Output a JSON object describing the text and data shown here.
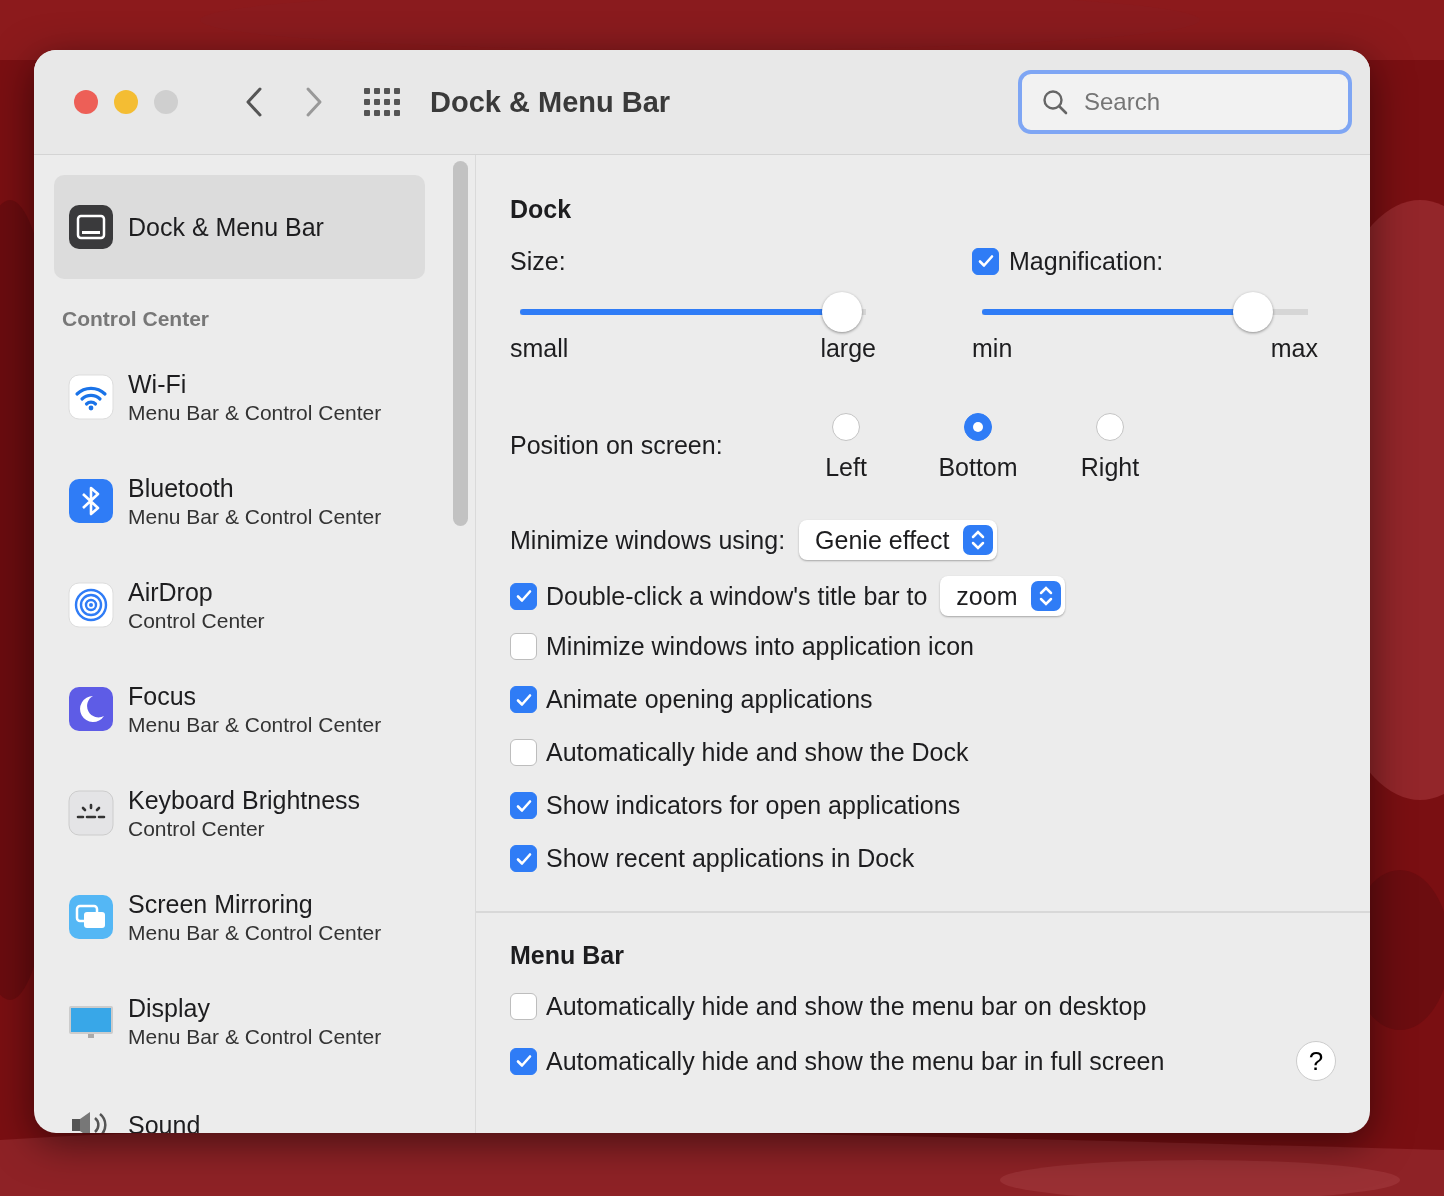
{
  "window": {
    "title": "Dock & Menu Bar"
  },
  "search": {
    "placeholder": "Search"
  },
  "sidebar": {
    "items": [
      {
        "kind": "item",
        "title": "Dock & Menu Bar",
        "selected": true
      },
      {
        "kind": "header",
        "title": "Control Center"
      },
      {
        "kind": "item",
        "title": "Wi-Fi",
        "subtitle": "Menu Bar & Control Center",
        "selected": false
      },
      {
        "kind": "item",
        "title": "Bluetooth",
        "subtitle": "Menu Bar & Control Center",
        "selected": false
      },
      {
        "kind": "item",
        "title": "AirDrop",
        "subtitle": "Control Center",
        "selected": false
      },
      {
        "kind": "item",
        "title": "Focus",
        "subtitle": "Menu Bar & Control Center",
        "selected": false
      },
      {
        "kind": "item",
        "title": "Keyboard Brightness",
        "subtitle": "Control Center",
        "selected": false
      },
      {
        "kind": "item",
        "title": "Screen Mirroring",
        "subtitle": "Menu Bar & Control Center",
        "selected": false
      },
      {
        "kind": "item",
        "title": "Display",
        "subtitle": "Menu Bar & Control Center",
        "selected": false
      },
      {
        "kind": "item",
        "title": "Sound",
        "selected": false
      }
    ]
  },
  "dock": {
    "title": "Dock",
    "size": {
      "label": "Size:",
      "level": 0.93,
      "min": "small",
      "max": "large"
    },
    "magnification": {
      "label": "Magnification:",
      "checked": true,
      "level": 0.83,
      "min": "min",
      "max": "max"
    },
    "position": {
      "label": "Position on screen:",
      "options": [
        {
          "label": "Left",
          "selected": false
        },
        {
          "label": "Bottom",
          "selected": true
        },
        {
          "label": "Right",
          "selected": false
        }
      ]
    },
    "minimize": {
      "label": "Minimize windows using:",
      "value": "Genie effect"
    },
    "options": [
      {
        "label": "Double-click a window's title bar to",
        "checked": true,
        "kind": "popup",
        "value": "zoom"
      },
      {
        "label": "Minimize windows into application icon",
        "checked": false,
        "kind": "plain"
      },
      {
        "label": "Animate opening applications",
        "checked": true,
        "kind": "plain"
      },
      {
        "label": "Automatically hide and show the Dock",
        "checked": false,
        "kind": "plain"
      },
      {
        "label": "Show indicators for open applications",
        "checked": true,
        "kind": "plain"
      },
      {
        "label": "Show recent applications in Dock",
        "checked": true,
        "kind": "plain"
      }
    ]
  },
  "menu_bar": {
    "title": "Menu Bar",
    "options": [
      {
        "label": "Automatically hide and show the menu bar on desktop",
        "checked": false
      },
      {
        "label": "Automatically hide and show the menu bar in full screen",
        "checked": true
      }
    ]
  },
  "help": "?"
}
